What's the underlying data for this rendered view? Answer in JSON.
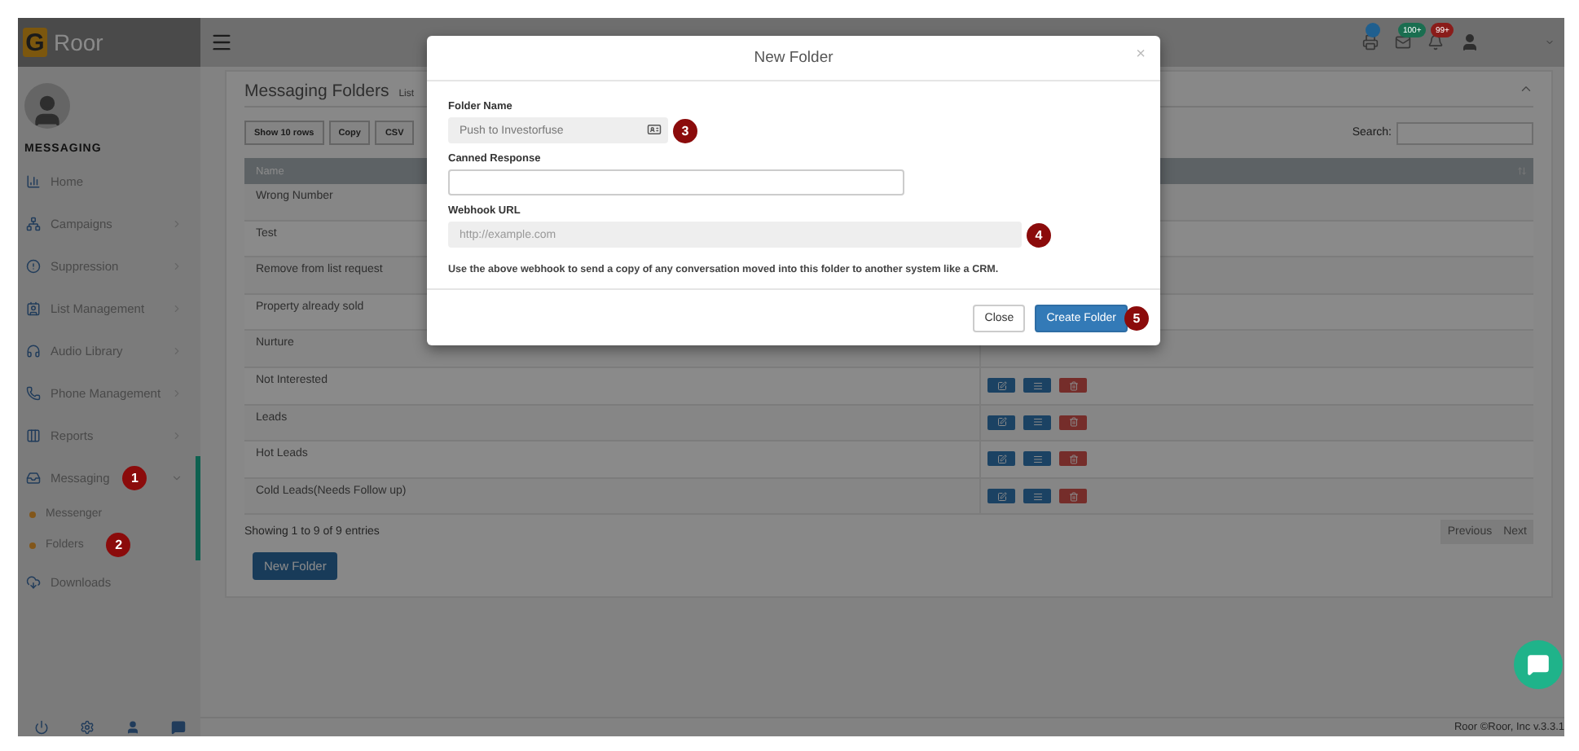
{
  "app": {
    "logo_letter": "G",
    "name": "Roor"
  },
  "topbar": {
    "badges": [
      {
        "color": "#1f5f8f"
      },
      {
        "text": "100+",
        "color": "#1a6e50"
      },
      {
        "text": "99+",
        "color": "#8a1c1a"
      }
    ]
  },
  "sidebar": {
    "section": "MESSAGING",
    "items": [
      {
        "label": "Home",
        "expandable": false,
        "active": false
      },
      {
        "label": "Campaigns",
        "expandable": true,
        "expanded": false,
        "active": false
      },
      {
        "label": "Suppression",
        "expandable": true,
        "expanded": false,
        "active": false
      },
      {
        "label": "List Management",
        "expandable": true,
        "expanded": false,
        "active": false
      },
      {
        "label": "Audio Library",
        "expandable": true,
        "expanded": false,
        "active": false
      },
      {
        "label": "Phone Management",
        "expandable": true,
        "expanded": false,
        "active": false
      },
      {
        "label": "Reports",
        "expandable": true,
        "expanded": false,
        "active": false
      },
      {
        "label": "Messaging",
        "expandable": true,
        "expanded": true,
        "active": true,
        "annotation": "1",
        "children": [
          {
            "label": "Messenger"
          },
          {
            "label": "Folders",
            "annotation": "2"
          }
        ]
      },
      {
        "label": "Downloads",
        "expandable": false,
        "active": false
      }
    ]
  },
  "page": {
    "title": "Messaging Folders",
    "subtitle": "List",
    "export_buttons": [
      "Show 10 rows",
      "Copy",
      "CSV"
    ],
    "search_label": "Search:",
    "table": {
      "columns": [
        "Name"
      ],
      "rows": [
        {
          "name": "Wrong Number"
        },
        {
          "name": "Test"
        },
        {
          "name": "Remove from list request"
        },
        {
          "name": "Property already sold"
        },
        {
          "name": "Nurture"
        },
        {
          "name": "Not Interested",
          "actions": true
        },
        {
          "name": "Leads",
          "actions": true
        },
        {
          "name": "Hot Leads",
          "actions": true
        },
        {
          "name": "Cold Leads(Needs Follow up)",
          "actions": true
        }
      ]
    },
    "info": "Showing 1 to 9 of 9 entries",
    "pagination": {
      "previous": "Previous",
      "next": "Next"
    },
    "new_button": "New Folder"
  },
  "footer": "Roor ©Roor, Inc v.3.3.1",
  "modal": {
    "title": "New Folder",
    "close": "×",
    "fields": [
      {
        "label": "Folder Name",
        "value": "Push to Investorfuse",
        "disabled": true,
        "annotation": "3"
      },
      {
        "label": "Canned Response",
        "disabled": false
      },
      {
        "label": "Webhook URL",
        "placeholder": "http://example.com",
        "disabled": true,
        "annotation": "4"
      }
    ],
    "help": "Use the above webhook to send a copy of any conversation moved into this folder to another system like a CRM.",
    "buttons": [
      {
        "label": "Close",
        "kind": "default"
      },
      {
        "label": "Create Folder",
        "kind": "primary",
        "annotation": "5"
      }
    ]
  }
}
